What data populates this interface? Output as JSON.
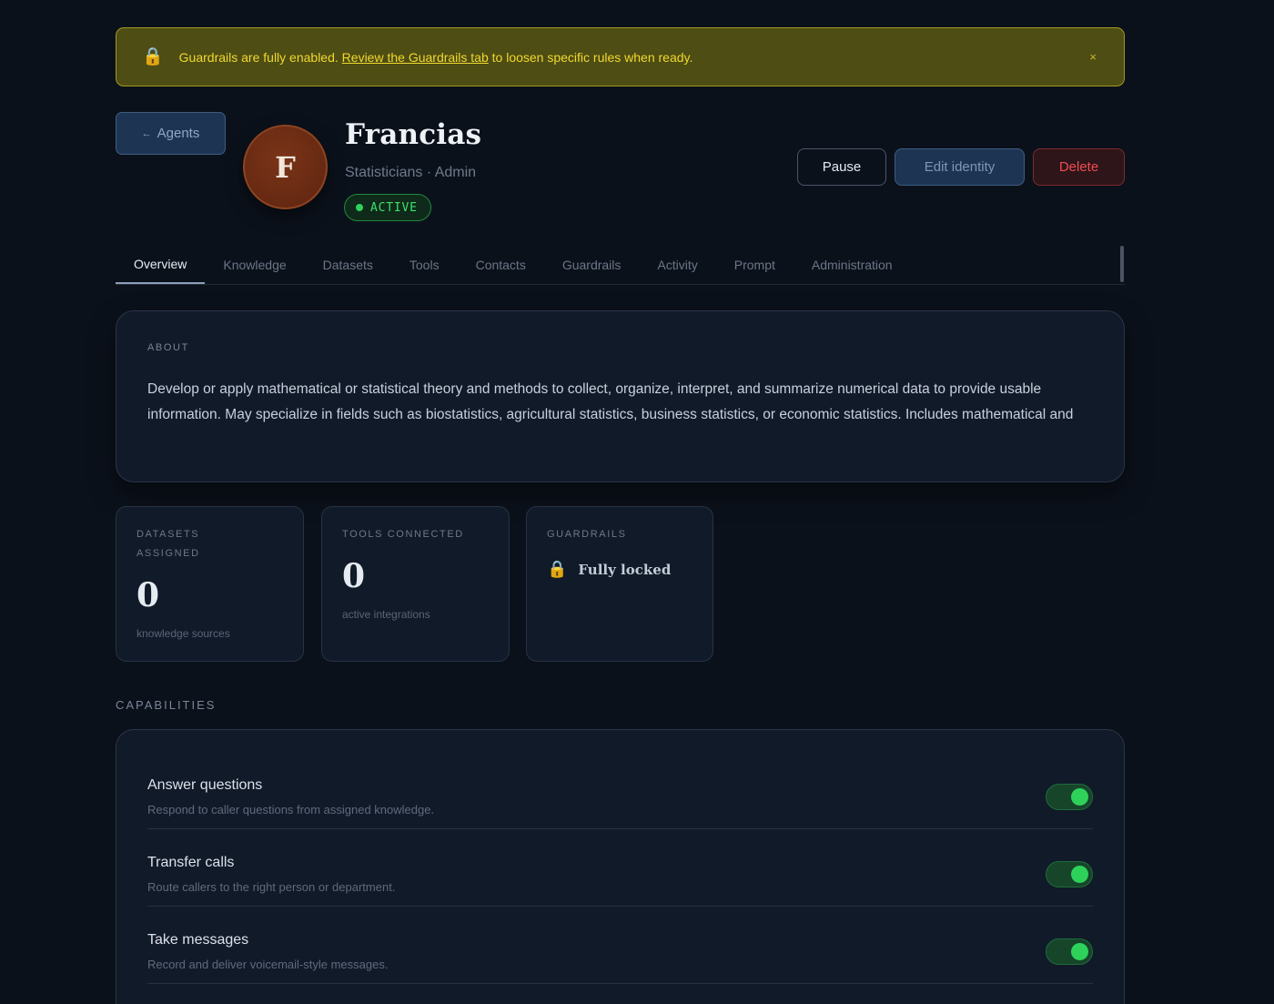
{
  "banner": {
    "icon": "lock-icon",
    "text_before": "Guardrails are fully enabled.",
    "link_text": "Review the Guardrails tab",
    "text_after": "to loosen specific rules when ready.",
    "close": "×"
  },
  "header": {
    "back_arrow": "←",
    "back_label": "Agents",
    "avatar_initial": "F",
    "name": "Francias",
    "role": "Statisticians · Admin",
    "status": "ACTIVE",
    "actions": {
      "pause": "Pause",
      "edit": "Edit identity",
      "delete": "Delete"
    }
  },
  "tabs": [
    {
      "label": "Overview",
      "active": true
    },
    {
      "label": "Knowledge"
    },
    {
      "label": "Datasets"
    },
    {
      "label": "Tools"
    },
    {
      "label": "Contacts"
    },
    {
      "label": "Guardrails"
    },
    {
      "label": "Activity"
    },
    {
      "label": "Prompt"
    },
    {
      "label": "Administration"
    }
  ],
  "about": {
    "label": "ABOUT",
    "text": "Develop or apply mathematical or statistical theory and methods to collect, organize, interpret, and summarize numerical data to provide usable information. May specialize in fields such as biostatistics, agricultural statistics, business statistics, or economic statistics. Includes mathematical and"
  },
  "stats": {
    "datasets": {
      "label_line1": "DATASETS",
      "label_line2": "ASSIGNED",
      "value": "0",
      "sub": "knowledge sources"
    },
    "tools": {
      "label": "TOOLS CONNECTED",
      "value": "0",
      "sub": "active integrations"
    },
    "guardrails": {
      "label": "GUARDRAILS",
      "icon": "lock-icon",
      "value": "Fully locked"
    }
  },
  "capabilities": {
    "heading": "CAPABILITIES",
    "items": [
      {
        "title": "Answer questions",
        "desc": "Respond to caller questions from assigned knowledge.",
        "enabled": true
      },
      {
        "title": "Transfer calls",
        "desc": "Route callers to the right person or department.",
        "enabled": true
      },
      {
        "title": "Take messages",
        "desc": "Record and deliver voicemail-style messages.",
        "enabled": true
      }
    ]
  },
  "colors": {
    "background": "#0b111b",
    "banner_bg": "#4e4d14",
    "banner_text": "#f0d92e",
    "status_green": "#3ee06b",
    "delete_red": "#ef4b52",
    "accent_blue": "#1d3553"
  }
}
